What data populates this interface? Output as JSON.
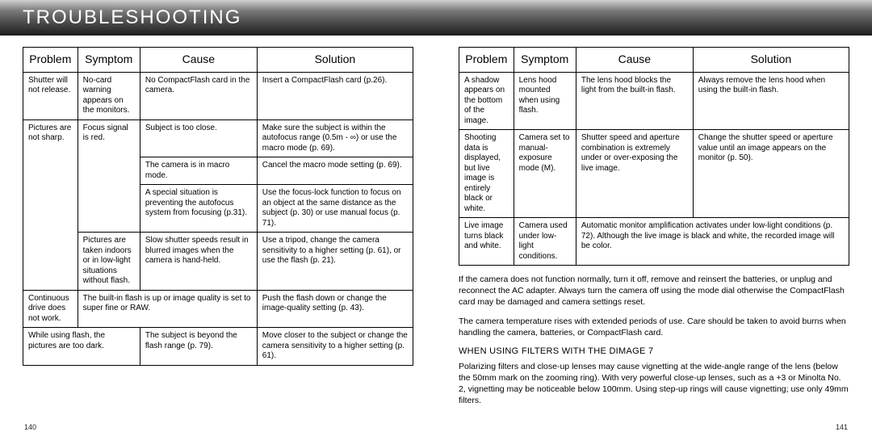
{
  "header": {
    "title": "TROUBLESHOOTING"
  },
  "columns": [
    "Problem",
    "Symptom",
    "Cause",
    "Solution"
  ],
  "leftTable": {
    "r1": {
      "problem": "Shutter will not release.",
      "symptom": "No-card warning appears on the monitors.",
      "cause": "No CompactFlash card in the camera.",
      "solution": "Insert a CompactFlash card (p.26)."
    },
    "r2": {
      "problem": "Pictures are not sharp.",
      "symptom": "Focus signal is red.",
      "cause1": "Subject is too close.",
      "solution1": "Make sure the subject is within the autofocus range (0.5m - ∞) or use the macro mode (p. 69).",
      "cause2": "The camera is in macro mode.",
      "solution2": "Cancel the macro mode setting (p. 69).",
      "cause3": "A special situation is preventing the autofocus system from focusing (p.31).",
      "solution3": "Use the focus-lock function to focus on an object at the same distance as the subject (p. 30) or use manual focus (p. 71)."
    },
    "r3": {
      "symptom": "Pictures are taken indoors or in low-light situations without flash.",
      "cause": "Slow shutter speeds result in blurred images when the camera is hand-held.",
      "solution": "Use a tripod, change the camera sensitivity to a higher setting (p. 61), or use the flash (p. 21)."
    },
    "r4": {
      "problem": "Continuous drive does not work.",
      "symptomcause": "The built-in flash is up or image quality is set to super fine or RAW.",
      "solution": "Push the flash down or change the image-quality setting (p. 43)."
    },
    "r5": {
      "problem": "While using flash, the pictures are too dark.",
      "cause": "The subject is beyond the flash range (p. 79).",
      "solution": "Move closer to the subject or change the camera sensitivity to a higher setting (p. 61)."
    }
  },
  "rightTable": {
    "r1": {
      "problem": "A shadow appears on the bottom of the image.",
      "symptom": "Lens hood mounted when using flash.",
      "cause": "The lens hood blocks the light from the built-in flash.",
      "solution": "Always remove the lens hood when using the built-in flash."
    },
    "r2": {
      "problem": "Shooting data is displayed, but live image is entirely black or white.",
      "symptom": "Camera set to manual-exposure mode (M).",
      "cause": "Shutter speed and aperture combination is extremely under or over-exposing the live image.",
      "solution": "Change the shutter speed or aperture value until an image appears on the monitor (p. 50)."
    },
    "r3": {
      "problem": "Live image turns black and white.",
      "symptom": "Camera used under low-light conditions.",
      "causesolution": "Automatic monitor amplification activates under low-light conditions (p. 72). Although the live image is black and white, the recorded image will be color."
    }
  },
  "body": {
    "p1": "If the camera does not function normally, turn it off, remove and reinsert the batteries, or unplug and reconnect the AC adapter. Always turn the camera off using the mode dial otherwise the CompactFlash card may be damaged and camera settings reset.",
    "p2": "The camera temperature rises with extended periods of use. Care should be taken to avoid burns when handling the camera, batteries, or CompactFlash card.",
    "h1": "WHEN USING FILTERS WITH THE DIMAGE 7",
    "p3": "Polarizing filters and close-up lenses may cause vignetting at the wide-angle range of the lens (below the 50mm mark on the zooming ring). With very powerful close-up lenses, such as a +3 or Minolta No. 2, vignetting may be noticeable below 100mm.  Using step-up rings will cause vignetting; use only 49mm filters."
  },
  "pages": {
    "left": "140",
    "right": "141"
  }
}
